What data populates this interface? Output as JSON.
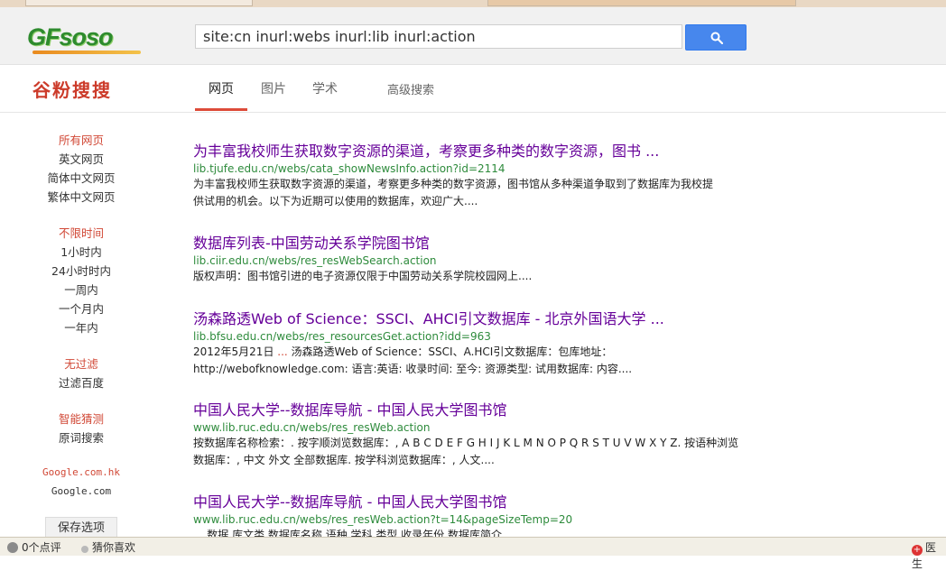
{
  "header": {
    "logo_text": "GFsoso",
    "search_value": "site:cn inurl:webs inurl:lib inurl:action"
  },
  "nav": {
    "brand": "谷粉搜搜",
    "tabs": [
      {
        "label": "网页",
        "active": true
      },
      {
        "label": "图片"
      },
      {
        "label": "学术"
      },
      {
        "label": "高级搜索"
      }
    ]
  },
  "sidebar": {
    "language": [
      "所有网页",
      "英文网页",
      "简体中文网页",
      "繁体中文网页"
    ],
    "time": [
      "不限时间",
      "1小时内",
      "24小时时内",
      "一周内",
      "一个月内",
      "一年内"
    ],
    "filter": [
      "无过滤",
      "过滤百度"
    ],
    "guess": [
      "智能猜测",
      "原词搜索"
    ],
    "domains": [
      "Google.com.hk",
      "Google.com"
    ],
    "save_label": "保存选项"
  },
  "results": [
    {
      "title": "为丰富我校师生获取数字资源的渠道，考察更多种类的数字资源，图书 ...",
      "url": "lib.tjufe.edu.cn/webs/cata_showNewsInfo.action?id=2114",
      "snippet_1": "为丰富我校师生获取数字资源的渠道，考察更多种类的数字资源，图书馆从多种渠道争取到了数据库为我校提",
      "snippet_2": "供试用的机会。以下为近期可以使用的数据库，欢迎广大...."
    },
    {
      "title": "数据库列表-中国劳动关系学院图书馆",
      "url": "lib.ciir.edu.cn/webs/res_resWebSearch.action",
      "snippet_1": "版权声明：图书馆引进的电子资源仅限于中国劳动关系学院校园网上...."
    },
    {
      "title": "汤森路透Web of Science：SSCI、AHCI引文数据库 - 北京外国语大学 ...",
      "url": "lib.bfsu.edu.cn/webs/res_resourcesGet.action?idd=963",
      "snippet_date": "2012年5月21日",
      "snippet_ellipsis": "...",
      "snippet_1": " 汤森路透Web of Science：SSCI、A.HCI引文数据库：包库地址：",
      "snippet_2": "http://webofknowledge.com: 语言:英语: 收录时间: 至今: 资源类型: 试用数据库: 内容...."
    },
    {
      "title": "中国人民大学--数据库导航 - 中国人民大学图书馆",
      "url": "www.lib.ruc.edu.cn/webs/res_resWeb.action",
      "snippet_1": "按数据库名称检索：. 按字顺浏览数据库：, A B C D E F G H I J K L M N O P Q R S T U V W X Y Z. 按语种浏览",
      "snippet_2": "数据库：, 中文 外文 全部数据库. 按学科浏览数据库：, 人文...."
    },
    {
      "title": "中国人民大学--数据库导航 - 中国人民大学图书馆",
      "url": "www.lib.ruc.edu.cn/webs/res_resWeb.action?t=14&pageSizeTemp=20",
      "snippet_1": "... 数据 库文类 数据库名称 语种 学科 类型 收录年份 数据库简介"
    }
  ],
  "status": {
    "comments": "0个点评",
    "guess_like": "猜你喜欢",
    "right_label": "医生"
  },
  "colors": {
    "title_purple": "#660099",
    "url_green": "#2e8b3c",
    "accent_red": "#d14836",
    "search_blue": "#4787ed"
  }
}
